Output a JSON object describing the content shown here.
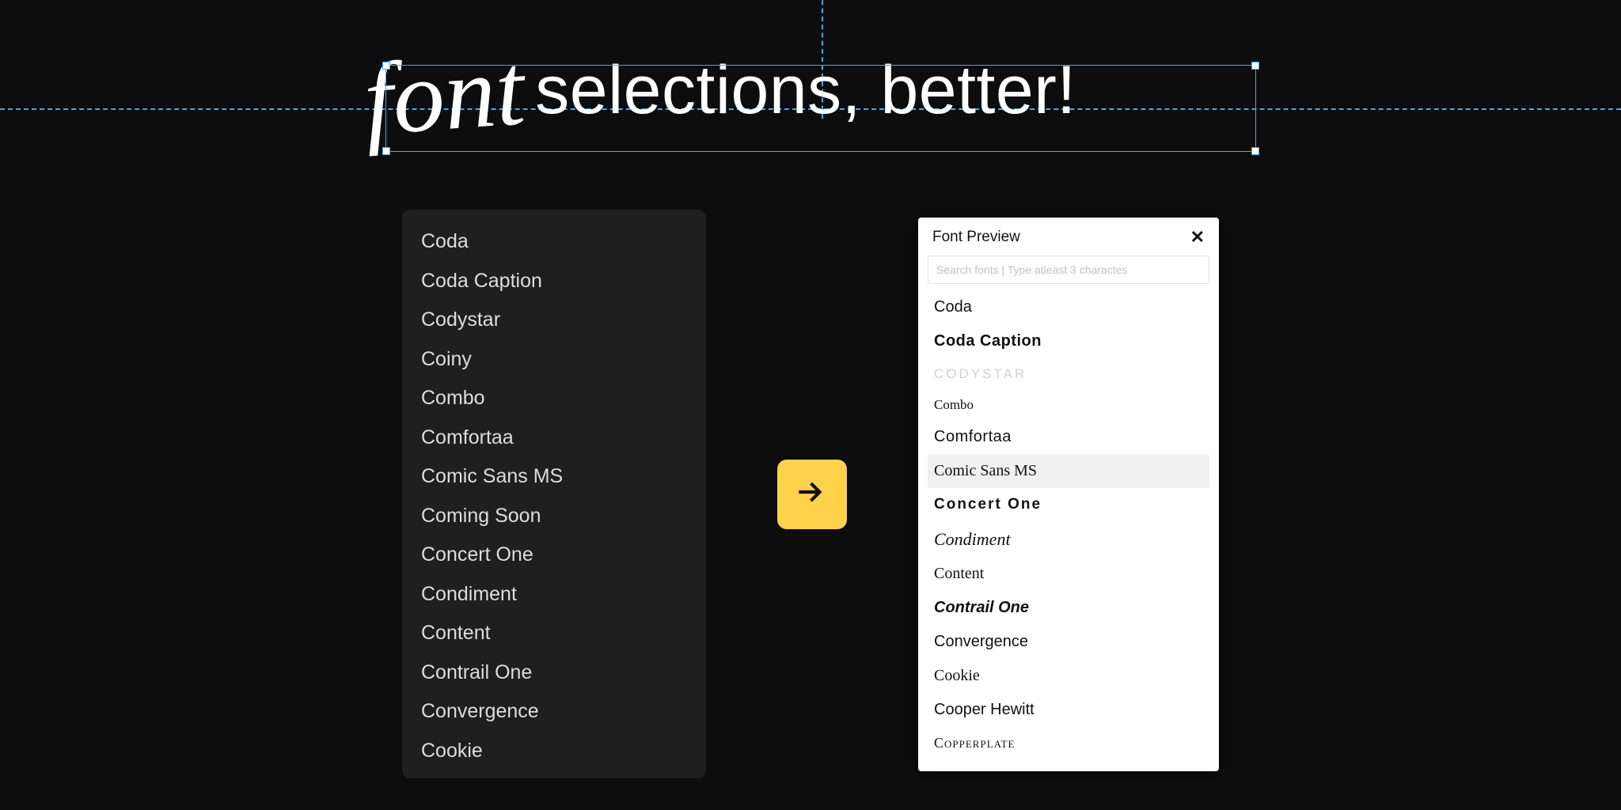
{
  "title": {
    "script": "font",
    "rest": "selections, better!"
  },
  "leftPanel": {
    "items": [
      "Coda",
      "Coda Caption",
      "Codystar",
      "Coiny",
      "Combo",
      "Comfortaa",
      "Comic Sans MS",
      "Coming Soon",
      "Concert One",
      "Condiment",
      "Content",
      "Contrail One",
      "Convergence",
      "Cookie"
    ]
  },
  "arrow": {
    "name": "arrow-right"
  },
  "rightPanel": {
    "title": "Font Preview",
    "search_placeholder": "Search fonts | Type atleast 3 charactes",
    "items": [
      {
        "label": "Coda",
        "styleClass": "f-coda",
        "selected": false
      },
      {
        "label": "Coda Caption",
        "styleClass": "f-codacaption",
        "selected": false
      },
      {
        "label": "CODYSTAR",
        "styleClass": "f-codystar",
        "selected": false
      },
      {
        "label": "Combo",
        "styleClass": "f-combo",
        "selected": false
      },
      {
        "label": "Comfortaa",
        "styleClass": "f-comfortaa",
        "selected": false
      },
      {
        "label": "Comic Sans MS",
        "styleClass": "f-comicsans",
        "selected": true
      },
      {
        "label": "Concert One",
        "styleClass": "f-concertone",
        "selected": false
      },
      {
        "label": "Condiment",
        "styleClass": "f-condiment",
        "selected": false
      },
      {
        "label": "Content",
        "styleClass": "f-content",
        "selected": false
      },
      {
        "label": "Contrail One",
        "styleClass": "f-contrailone",
        "selected": false
      },
      {
        "label": "Convergence",
        "styleClass": "f-convergence",
        "selected": false
      },
      {
        "label": "Cookie",
        "styleClass": "f-cookie",
        "selected": false
      },
      {
        "label": "Cooper Hewitt",
        "styleClass": "f-cooperhewitt",
        "selected": false
      },
      {
        "label": "Copperplate",
        "styleClass": "f-copperplate",
        "selected": false
      }
    ]
  },
  "colors": {
    "guide": "#3fa9f5",
    "arrowBg": "#ffd24a"
  }
}
